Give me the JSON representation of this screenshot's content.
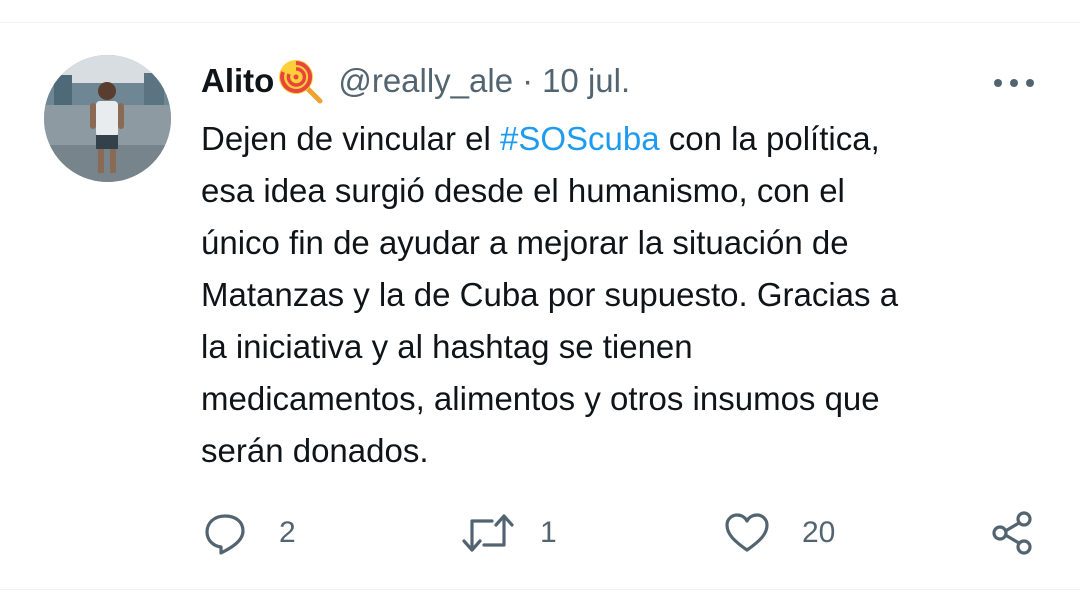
{
  "tweet": {
    "author": {
      "display_name": "Alito",
      "name_emoji": "lollipop-emoji",
      "handle": "@really_ale",
      "avatar": "profile-photo"
    },
    "separator": "·",
    "date": "10 jul.",
    "text_lines": [
      {
        "before": "Dejen de vincular el ",
        "hashtag": "#SOScuba",
        "after": " con la política,"
      },
      {
        "text": "esa idea surgió desde el humanismo, con el"
      },
      {
        "text": "único fin de ayudar a mejorar la situación de"
      },
      {
        "text": "Matanzas y la de Cuba por supuesto. Gracias a"
      },
      {
        "text": "la iniciativa y al hashtag se tienen"
      },
      {
        "text": "medicamentos, alimentos y otros insumos que"
      },
      {
        "text": "serán donados."
      }
    ],
    "actions": {
      "reply": {
        "icon": "reply-icon",
        "count": "2"
      },
      "retweet": {
        "icon": "retweet-icon",
        "count": "1"
      },
      "like": {
        "icon": "heart-icon",
        "count": "20"
      },
      "share": {
        "icon": "share-icon"
      }
    },
    "more_icon": "more-options-icon"
  },
  "colors": {
    "text": "#0f1419",
    "secondary": "#536471",
    "hashtag": "#1d9bf0",
    "divider": "#eff3f4"
  }
}
